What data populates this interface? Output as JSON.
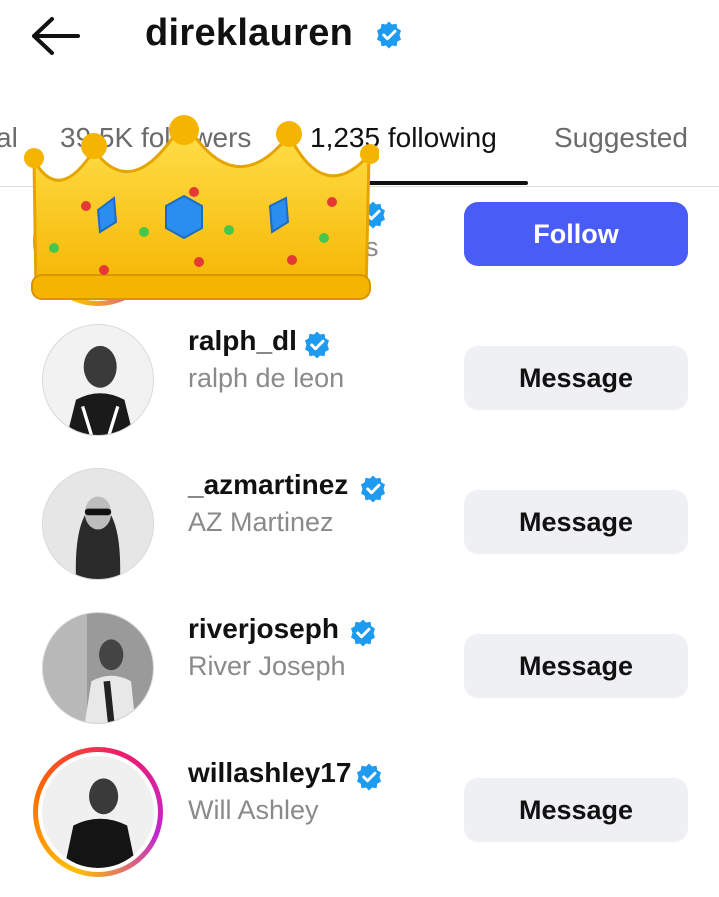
{
  "header": {
    "back_icon": "arrow-left-icon",
    "title": "direklauren",
    "verified_icon": "verified-badge-icon"
  },
  "tabs": [
    {
      "label": "al",
      "active": false
    },
    {
      "label": "39.5K followers",
      "active": false
    },
    {
      "label": "1,235 following",
      "active": true
    },
    {
      "label": "Suggested",
      "active": false
    }
  ],
  "partial_row": {
    "subtitle_fragment": "es",
    "button_label": "Follow",
    "accent": "#4a5cf6"
  },
  "accounts": [
    {
      "username": "ralph_dl",
      "full_name": "ralph de leon",
      "verified": true,
      "button": "Message"
    },
    {
      "username": "_azmartinez",
      "full_name": "AZ Martinez",
      "verified": true,
      "button": "Message"
    },
    {
      "username": "riverjoseph",
      "full_name": "River Joseph",
      "verified": true,
      "button": "Message"
    },
    {
      "username": "willashley17",
      "full_name": "Will Ashley",
      "verified": true,
      "button": "Message",
      "has_story": true
    }
  ],
  "colors": {
    "verified_blue": "#1d9bf0",
    "follow_button": "#4a5cf6",
    "message_button": "#eff0f4",
    "secondary_text": "#8a8a8a"
  },
  "sticker": "crown-emoji"
}
